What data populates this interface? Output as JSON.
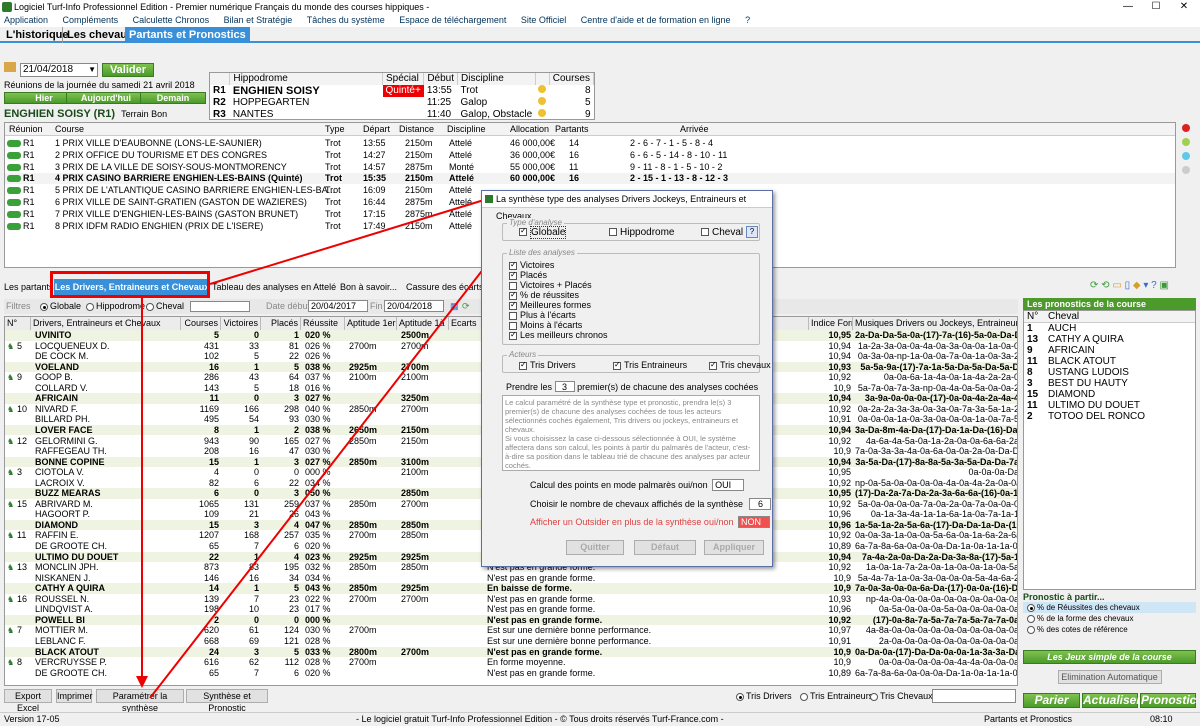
{
  "window": {
    "title": "Logiciel Turf-Info Professionnel Edition - Premier numérique Français du monde des courses hippiques -",
    "controls": [
      "—",
      "☐",
      "✕"
    ]
  },
  "menu": [
    "Application",
    "Compléments",
    "Calculette Chronos",
    "Bilan et Stratégie",
    "Tâches du système",
    "Espace de téléchargement",
    "Site Officiel",
    "Centre d'aide et de formation en ligne",
    "?"
  ],
  "top_tabs": [
    "L'historique",
    "Les chevaux",
    "Partants et Pronostics"
  ],
  "date": {
    "value": "21/04/2018",
    "valider": "Valider",
    "reunions_text": "Réunions de la journée du samedi 21 avril 2018",
    "hier": "Hier",
    "aujourdhui": "Aujourd'hui",
    "demain": "Demain"
  },
  "selected": {
    "label": "ENGHIEN SOISY (R1)",
    "terrain": "Terrain Bon"
  },
  "reunions": {
    "headers": [
      "Hippodrome",
      "Spécial",
      "Début",
      "Discipline",
      "Courses"
    ],
    "rows": [
      {
        "r": "R1",
        "hippo": "ENGHIEN SOISY",
        "special": "Quinté+",
        "debut": "13:55",
        "disc": "Trot",
        "courses": "8"
      },
      {
        "r": "R2",
        "hippo": "HOPPEGARTEN",
        "special": "",
        "debut": "11:25",
        "disc": "Galop",
        "courses": "5"
      },
      {
        "r": "R3",
        "hippo": "NANTES",
        "special": "",
        "debut": "11:40",
        "disc": "Galop, Obstacle",
        "courses": "9"
      }
    ]
  },
  "courses": {
    "headers": [
      "Réunion",
      "Course",
      "Type",
      "Départ",
      "Distance",
      "Discipline",
      "Allocation",
      "Partants",
      "Arrivée"
    ],
    "rows": [
      {
        "r": "R1",
        "c": "1 PRIX VILLE D'EAUBONNE (LONS-LE-SAUNIER)",
        "t": "Trot",
        "d": "13:55",
        "dist": "2150m",
        "disc": "Attelé",
        "alloc": "46 000,00€",
        "p": "14",
        "a": "2 - 6 - 7 - 1 - 5 - 8 - 4"
      },
      {
        "r": "R1",
        "c": "2 PRIX OFFICE DU TOURISME ET DES CONGRES",
        "t": "Trot",
        "d": "14:27",
        "dist": "2150m",
        "disc": "Attelé",
        "alloc": "36 000,00€",
        "p": "16",
        "a": "6 - 6 - 5 - 14 - 8 - 10 - 11"
      },
      {
        "r": "R1",
        "c": "3 PRIX DE LA VILLE DE SOISY-SOUS-MONTMORENCY",
        "t": "Trot",
        "d": "14:57",
        "dist": "2875m",
        "disc": "Monté",
        "alloc": "55 000,00€",
        "p": "11",
        "a": "9 - 11 - 8 - 1 - 5 - 10 - 2"
      },
      {
        "r": "R1",
        "c": "4 PRIX CASINO BARRIERE ENGHIEN-LES-BAINS (Quinté)",
        "t": "Trot",
        "d": "15:35",
        "dist": "2150m",
        "disc": "Attelé",
        "alloc": "60 000,00€",
        "p": "16",
        "a": "2 - 15 - 1 - 13 - 8 - 12 - 3"
      },
      {
        "r": "R1",
        "c": "5 PRIX DE L'ATLANTIQUE CASINO BARRIERE ENGHIEN-LES-BA...",
        "t": "Trot",
        "d": "16:09",
        "dist": "2150m",
        "disc": "Attelé",
        "alloc": "",
        "p": "",
        "a": ""
      },
      {
        "r": "R1",
        "c": "6 PRIX VILLE DE SAINT-GRATIEN (GASTON DE WAZIERES)",
        "t": "Trot",
        "d": "16:44",
        "dist": "2875m",
        "disc": "Attelé",
        "alloc": "",
        "p": "",
        "a": ""
      },
      {
        "r": "R1",
        "c": "7 PRIX VILLE D'ENGHIEN-LES-BAINS (GASTON BRUNET)",
        "t": "Trot",
        "d": "17:15",
        "dist": "2875m",
        "disc": "Attelé",
        "alloc": "",
        "p": "",
        "a": ""
      },
      {
        "r": "R1",
        "c": "8 PRIX IDFM RADIO ENGHIEN (PRIX DE L'ISERE)",
        "t": "Trot",
        "d": "17:49",
        "dist": "2150m",
        "disc": "Attelé",
        "alloc": "",
        "p": "",
        "a": ""
      }
    ]
  },
  "sub_tabs": [
    "Les partants",
    "Les Drivers, Entraineurs et Chevaux",
    "Tableau des analyses en Attelé",
    "Bon à savoir...",
    "Cassure des écarts"
  ],
  "filters": {
    "label": "Filtres",
    "globale": "Globale",
    "hippodrome": "Hippodrome",
    "cheval": "Cheval",
    "date_debut_label": "Date début",
    "date_debut": "20/04/2017",
    "fin_label": "Fin",
    "fin": "20/04/2018"
  },
  "grid": {
    "headers": [
      "N°",
      "Drivers, Entraineurs et Chevaux",
      "Courses",
      "Victoires",
      "Placés",
      "Réussite",
      "Aptitude 1er",
      "Aptitude 1à",
      "Ecarts"
    ],
    "right_headers": [
      "Indice Forme",
      "Musiques Drivers ou Jockeys, Entraineurs et Ch"
    ],
    "rows": [
      {
        "n": "",
        "name": "UVINITO",
        "c": "5",
        "v": "0",
        "p": "1",
        "r": "020 %",
        "a1": "",
        "a2": "2500m",
        "g": true,
        "f": "10,95",
        "m": "2a-Da-Da-5a-0a-(17)-7a-(16)-5a-0a-Da-D"
      },
      {
        "n": "5",
        "name": "LOCQUENEUX D.",
        "c": "431",
        "v": "33",
        "p": "81",
        "r": "026 %",
        "a1": "2700m",
        "a2": "2700m",
        "f": "10,94",
        "m": "1a-2a-3a-0a-0a-4a-0a-3a-0a-0a-1a-0a-0"
      },
      {
        "n": "",
        "name": "DE COCK M.",
        "c": "102",
        "v": "5",
        "p": "22",
        "r": "026 %",
        "a1": "",
        "a2": "",
        "f": "10,94",
        "m": "0a-3a-0a-np-1a-0a-0a-7a-0a-1a-0a-3a-2"
      },
      {
        "n": "",
        "name": "VOELAND",
        "c": "16",
        "v": "1",
        "p": "5",
        "r": "038 %",
        "a1": "2925m",
        "a2": "2700m",
        "g": true,
        "f": "10,93",
        "m": "5a-5a-9a-(17)-7a-1a-5a-Da-5a-Da-5a-D"
      },
      {
        "n": "9",
        "name": "GOOP B.",
        "c": "286",
        "v": "43",
        "p": "64",
        "r": "037 %",
        "a1": "2100m",
        "a2": "2100m",
        "f": "10,92",
        "m": "0a-0a-6a-1a-4a-0a-1a-4a-2a-2a-0"
      },
      {
        "n": "",
        "name": "COLLARD V.",
        "c": "143",
        "v": "5",
        "p": "18",
        "r": "016 %",
        "a1": "",
        "a2": "",
        "f": "10,9",
        "m": "5a-7a-0a-7a-3a-np-0a-4a-0a-5a-0a-0a-2"
      },
      {
        "n": "",
        "name": "AFRICAIN",
        "c": "11",
        "v": "0",
        "p": "3",
        "r": "027 %",
        "a1": "",
        "a2": "3250m",
        "g": true,
        "f": "10,94",
        "m": "3a-9a-0a-0a-0a-(17)-0a-0a-4a-2a-4a-4"
      },
      {
        "n": "10",
        "name": "NIVARD F.",
        "c": "1169",
        "v": "166",
        "p": "298",
        "r": "040 %",
        "a1": "2850m",
        "a2": "2700m",
        "f": "10,92",
        "m": "0a-2a-2a-3a-3a-0a-3a-0a-7a-3a-5a-1a-2"
      },
      {
        "n": "",
        "name": "BILLARD PH.",
        "c": "495",
        "v": "54",
        "p": "93",
        "r": "030 %",
        "a1": "",
        "a2": "",
        "f": "10,91",
        "m": "0a-0a-0a-1a-0a-3a-0a-0a-0a-1a-0a-7a-5"
      },
      {
        "n": "",
        "name": "LOVER FACE",
        "c": "8",
        "v": "1",
        "p": "2",
        "r": "038 %",
        "a1": "2650m",
        "a2": "2150m",
        "g": true,
        "f": "10,94",
        "m": "3a-Da-8m-4a-Da-(17)-Da-1a-Da-(16)-Da-Da"
      },
      {
        "n": "12",
        "name": "GELORMINI G.",
        "c": "943",
        "v": "90",
        "p": "165",
        "r": "027 %",
        "a1": "2850m",
        "a2": "2150m",
        "f": "10,92",
        "m": "4a-6a-4a-5a-0a-1a-2a-0a-0a-6a-6a-2a"
      },
      {
        "n": "",
        "name": "RAFFEGEAU TH.",
        "c": "208",
        "v": "16",
        "p": "47",
        "r": "030 %",
        "a1": "",
        "a2": "",
        "f": "10,9",
        "m": "7a-0a-3a-3a-4a-0a-6a-0a-0a-2a-0a-Da-Dm"
      },
      {
        "n": "",
        "name": "BONNE COPINE",
        "c": "15",
        "v": "1",
        "p": "3",
        "r": "027 %",
        "a1": "2850m",
        "a2": "3100m",
        "g": true,
        "f": "10,94",
        "m": "3a-5a-Da-(17)-8a-8a-5a-3a-5a-Da-Da-7a"
      },
      {
        "n": "3",
        "name": "CIOTOLA V.",
        "c": "4",
        "v": "0",
        "p": "0",
        "r": "000 %",
        "a1": "",
        "a2": "2100m",
        "f": "10,95",
        "m": "0a-0a-0a-Da"
      },
      {
        "n": "",
        "name": "LACROIX V.",
        "c": "82",
        "v": "6",
        "p": "22",
        "r": "034 %",
        "a1": "",
        "a2": "",
        "f": "10,92",
        "m": "np-0a-5a-0a-0a-0a-0a-4a-0a-4a-2a-0a-0a"
      },
      {
        "n": "",
        "name": "BUZZ MEARAS",
        "c": "6",
        "v": "0",
        "p": "3",
        "r": "050 %",
        "a1": "",
        "a2": "2850m",
        "g": true,
        "f": "10,95",
        "m": "(17)-Da-2a-7a-Da-2a-3a-6a-6a-(16)-0a-1a-"
      },
      {
        "n": "15",
        "name": "ABRIVARD M.",
        "c": "1065",
        "v": "131",
        "p": "259",
        "r": "037 %",
        "a1": "2850m",
        "a2": "2700m",
        "f": "10,92",
        "m": "5a-0a-0a-0a-0a-7a-0a-2a-0a-7a-0a-0a-0"
      },
      {
        "n": "",
        "name": "HAGOORT P.",
        "c": "109",
        "v": "21",
        "p": "26",
        "r": "043 %",
        "a1": "",
        "a2": "",
        "f": "10,96",
        "m": "0a-1a-3a-4a-1a-1a-6a-1a-0a-7a-1a-1"
      },
      {
        "n": "",
        "name": "DIAMOND",
        "c": "15",
        "v": "3",
        "p": "4",
        "r": "047 %",
        "a1": "2850m",
        "a2": "2850m",
        "g": true,
        "f": "10,96",
        "m": "1a-5a-1a-2a-5a-6a-(17)-Da-Da-1a-Da-(16)"
      },
      {
        "n": "11",
        "name": "RAFFIN E.",
        "c": "1207",
        "v": "168",
        "p": "257",
        "r": "035 %",
        "a1": "2700m",
        "a2": "2850m",
        "f": "10,92",
        "m": "0a-0a-3a-1a-0a-0a-5a-6a-0a-1a-6a-2a-6a"
      },
      {
        "n": "",
        "name": "DE GROOTE CH.",
        "c": "65",
        "v": "7",
        "p": "6",
        "r": "020 %",
        "a1": "",
        "a2": "",
        "f": "10,89",
        "m": "6a-7a-8a-6a-0a-0a-0a-Da-1a-0a-1a-1a-0a"
      },
      {
        "n": "",
        "name": "ULTIMO DU DOUET",
        "c": "22",
        "v": "1",
        "p": "4",
        "r": "023 %",
        "a1": "2925m",
        "a2": "2925m",
        "g": true,
        "f": "10,94",
        "m": "7a-4a-2a-0a-Da-2a-Da-3a-8a-(17)-5a-1"
      },
      {
        "n": "13",
        "name": "MONCLIN JPH.",
        "c": "873",
        "v": "83",
        "p": "195",
        "r": "032 %",
        "a1": "2850m",
        "a2": "2850m",
        "e": "N'est pas en grande forme.",
        "f": "10,92",
        "m": "1a-0a-1a-7a-2a-0a-1a-0a-0a-1a-0a-5a"
      },
      {
        "n": "",
        "name": "NISKANEN J.",
        "c": "146",
        "v": "16",
        "p": "34",
        "r": "034 %",
        "a1": "",
        "a2": "",
        "e": "N'est pas en grande forme.",
        "f": "10,9",
        "m": "5a-4a-7a-1a-0a-3a-0a-0a-0a-5a-4a-6a-2"
      },
      {
        "n": "",
        "name": "CATHY A QUIRA",
        "c": "14",
        "v": "1",
        "p": "5",
        "r": "043 %",
        "a1": "2850m",
        "a2": "2925m",
        "g": true,
        "e": "En baisse de forme.",
        "f": "10,9",
        "m": "7a-0a-3a-0a-0a-6a-Da-(17)-0a-0a-(16)-Da"
      },
      {
        "n": "16",
        "name": "ROUSSEL N.",
        "c": "139",
        "v": "7",
        "p": "23",
        "r": "022 %",
        "a1": "2700m",
        "a2": "2700m",
        "e": "N'est pas en grande forme.",
        "f": "10,93",
        "m": "np-4a-0a-0a-0a-0a-0a-0a-0a-0a-0a-0a"
      },
      {
        "n": "",
        "name": "LINDQVIST A.",
        "c": "198",
        "v": "10",
        "p": "23",
        "r": "017 %",
        "a1": "",
        "a2": "",
        "e": "N'est pas en grande forme.",
        "f": "10,96",
        "m": "0a-5a-0a-0a-0a-5a-0a-0a-0a-0a-0a"
      },
      {
        "n": "",
        "name": "POWELL BI",
        "c": "2",
        "v": "0",
        "p": "0",
        "r": "000 %",
        "a1": "",
        "a2": "",
        "g": true,
        "e": "N'est pas en grande forme.",
        "f": "10,92",
        "m": "(17)-0a-8a-7a-5a-7a-7a-5a-7a-7a-0a"
      },
      {
        "n": "7",
        "name": "MOTTIER M.",
        "c": "620",
        "v": "61",
        "p": "124",
        "r": "030 %",
        "a1": "2700m",
        "a2": "",
        "e": "Est sur une dernière bonne performance.",
        "f": "10,97",
        "m": "4a-8a-0a-0a-0a-0a-0a-0a-0a-0a-0a-0a"
      },
      {
        "n": "",
        "name": "LEBLANC F.",
        "c": "668",
        "v": "69",
        "p": "121",
        "r": "028 %",
        "a1": "",
        "a2": "",
        "e": "Est sur une dernière bonne performance.",
        "f": "10,91",
        "m": "2a-0a-0a-0a-0a-0a-0a-0a-0a-0a-0a"
      },
      {
        "n": "",
        "name": "BLACK ATOUT",
        "c": "24",
        "v": "3",
        "p": "5",
        "r": "033 %",
        "a1": "2800m",
        "a2": "2700m",
        "g": true,
        "e": "N'est pas en grande forme.",
        "f": "10,9",
        "m": "0a-Da-0a-(17)-Da-Da-0a-0a-1a-3a-3a-Da-6"
      },
      {
        "n": "8",
        "name": "VERCRUYSSE P.",
        "c": "616",
        "v": "62",
        "p": "112",
        "r": "028 %",
        "a1": "2700m",
        "a2": "",
        "e": "En forme moyenne.",
        "f": "10,9",
        "m": "0a-0a-0a-0a-0a-0a-4a-4a-0a-0a-0a"
      },
      {
        "n": "",
        "name": "DE GROOTE CH.",
        "c": "65",
        "v": "7",
        "p": "6",
        "r": "020 %",
        "a1": "",
        "a2": "",
        "e": "N'est pas en grande forme.",
        "f": "10,89",
        "m": "6a-7a-8a-6a-0a-0a-0a-Da-1a-0a-1a-1a-0a"
      }
    ]
  },
  "bottom": {
    "export": "Export Excel",
    "imprimer": "Imprimer",
    "param": "Paramétrer la synthèse",
    "synth": "Synthèse et Pronostic",
    "tris_drivers": "Tris Drivers",
    "tris_entraineurs": "Tris Entraineurs",
    "tris_chevaux": "Tris Chevaux"
  },
  "pronostics": {
    "title": "Les pronostics de la course",
    "col_n": "N°",
    "col_cheval": "Cheval",
    "rows": [
      {
        "n": "1",
        "c": "AUCH"
      },
      {
        "n": "13",
        "c": "CATHY A QUIRA"
      },
      {
        "n": "9",
        "c": "AFRICAIN"
      },
      {
        "n": "11",
        "c": "BLACK ATOUT"
      },
      {
        "n": "8",
        "c": "USTANG LUDOIS"
      },
      {
        "n": "3",
        "c": "BEST DU HAUTY"
      },
      {
        "n": "15",
        "c": "DIAMOND"
      },
      {
        "n": "11",
        "c": "ULTIMO DU DOUET"
      },
      {
        "n": "2",
        "c": "TOTOO DEL RONCO"
      }
    ],
    "partir_title": "Pronostic à partir...",
    "opt1": "% de Réussites des chevaux",
    "opt2": "% de la forme des chevaux",
    "opt3": "% des cotes de référence",
    "jeux": "Les Jeux simple de la course",
    "elim": "Elimination Automatique",
    "parier": "Parier",
    "actualiser": "Actualiser",
    "pronostic": "Pronostic"
  },
  "dialog": {
    "title": "La synthèse type des analyses Drivers Jockeys, Entraineurs et Chevaux",
    "type_legend": "Type d'analyse",
    "globale": "Globale",
    "hippodrome": "Hippodrome",
    "cheval": "Cheval",
    "liste_legend": "Liste des analyses",
    "analyses": [
      {
        "l": "Victoires",
        "on": true
      },
      {
        "l": "Placés",
        "on": true
      },
      {
        "l": "Victoires + Placés",
        "on": false
      },
      {
        "l": "% de réussites",
        "on": true
      },
      {
        "l": "Meilleures formes",
        "on": true
      },
      {
        "l": "Plus à l'écarts",
        "on": false
      },
      {
        "l": "Moins à l'écarts",
        "on": false
      },
      {
        "l": "Les meilleurs chronos",
        "on": true
      }
    ],
    "acteurs_legend": "Acteurs",
    "tris_drivers": "Tris Drivers",
    "tris_entraineurs": "Tris Entraineurs",
    "tris_chevaux": "Tris chevaux",
    "prendre_pre": "Prendre les",
    "prendre_val": "3",
    "prendre_post": "premier(s) de chacune des analyses cochées",
    "help": "Le calcul paramétré de la synthèse type et pronostic, prendra le(s) 3 premier(s) de chacune des analyses cochées de tous les acteurs sélectionnés cochés également, Tris drivers ou jockeys, entraineurs et chevaux.\nSi vous choisissez la case ci-dessous sélectionnée à OUI, le système affectera dans son calcul, les points à partir du palmarès de l'acteur, c'est-à-dire sa position dans le tableau trié de chacune des analyses par acteur cochés.",
    "calc_label": "Calcul des points en mode palmarès oui/non",
    "calc_val": "OUI",
    "nb_label": "Choisir le nombre de chevaux affichés de la synthèse",
    "nb_val": "6",
    "outsider_label": "Afficher un Outsider en plus de la synthèse oui/non",
    "outsider_val": "NON",
    "quitter": "Quitter",
    "defaut": "Défaut",
    "appliquer": "Appliquer"
  },
  "status": {
    "version": "Version 17-05",
    "center": "- Le logiciel gratuit Turf-Info Professionnel Edition - © Tous droits réservés Turf-France.com -",
    "section": "Partants et Pronostics",
    "time": "08:10"
  }
}
